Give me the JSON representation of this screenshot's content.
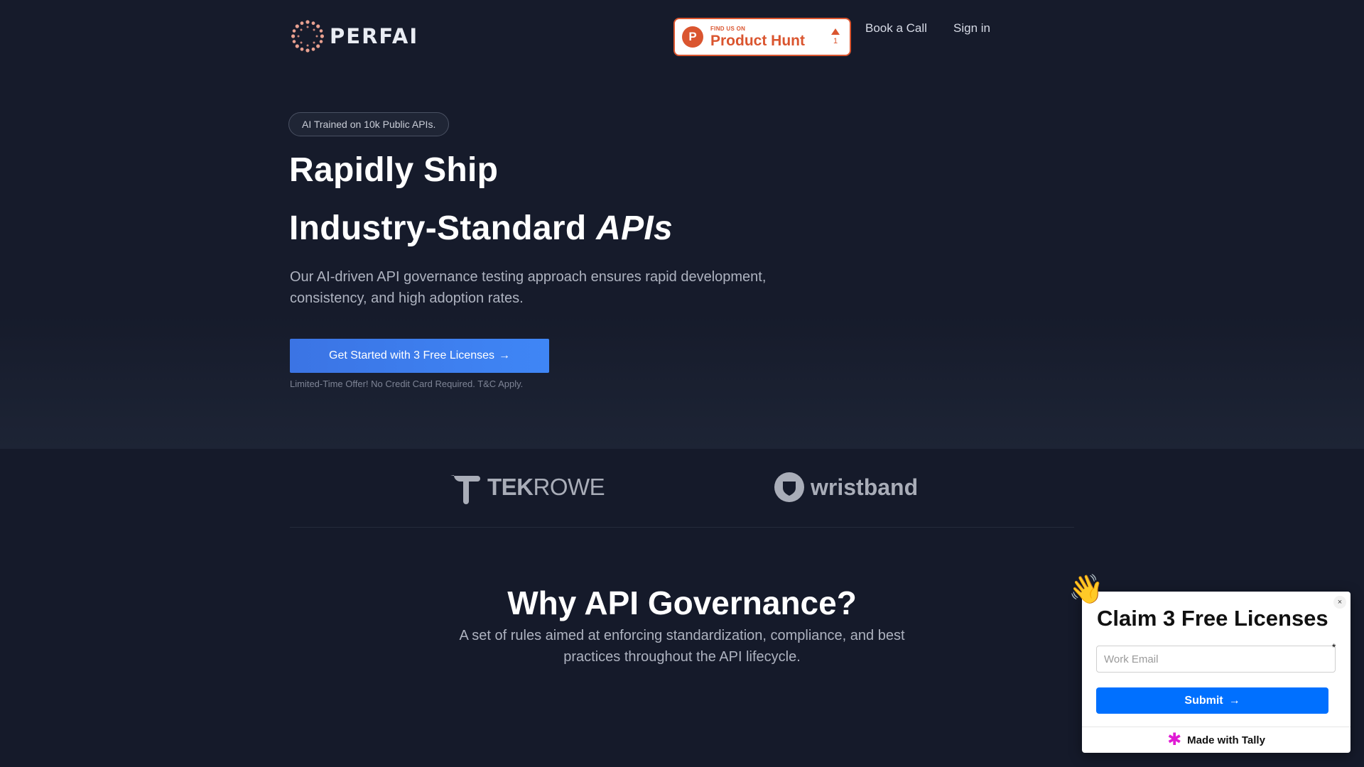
{
  "header": {
    "logo_text": "PERFAI",
    "product_hunt": {
      "small": "FIND US ON",
      "big": "Product Hunt",
      "votes": "1"
    },
    "nav": {
      "book_call": "Book a Call",
      "sign_in": "Sign in"
    }
  },
  "hero": {
    "pill": "AI Trained on 10k Public APIs.",
    "headline_line1": "Rapidly Ship",
    "headline_line2_plain": "Industry-Standard",
    "headline_line2_italic": "APIs",
    "subhead": "Our AI-driven API governance testing approach ensures rapid development, consistency, and high adoption rates.",
    "cta_label": "Get Started with 3 Free Licenses",
    "cta_arrow": "→",
    "cta_note": "Limited-Time Offer! No Credit Card Required. T&C Apply."
  },
  "clients": {
    "tekrowe": {
      "bold": "TEK",
      "light": "ROWE"
    },
    "wristband": "wristband"
  },
  "why": {
    "title": "Why API Governance?",
    "subtitle": "A set of rules aimed at enforcing standardization, compliance, and best practices throughout the API lifecycle."
  },
  "popup": {
    "wave_emoji": "👋",
    "close": "×",
    "title": "Claim 3 Free Licenses",
    "email_placeholder": "Work Email",
    "required_mark": "*",
    "submit_label": "Submit",
    "submit_arrow": "→",
    "footer": "Made with Tally"
  },
  "colors": {
    "background": "#161b2b",
    "cta": "#3f86f6",
    "product_hunt": "#da552f",
    "tally_submit": "#0070ff"
  }
}
